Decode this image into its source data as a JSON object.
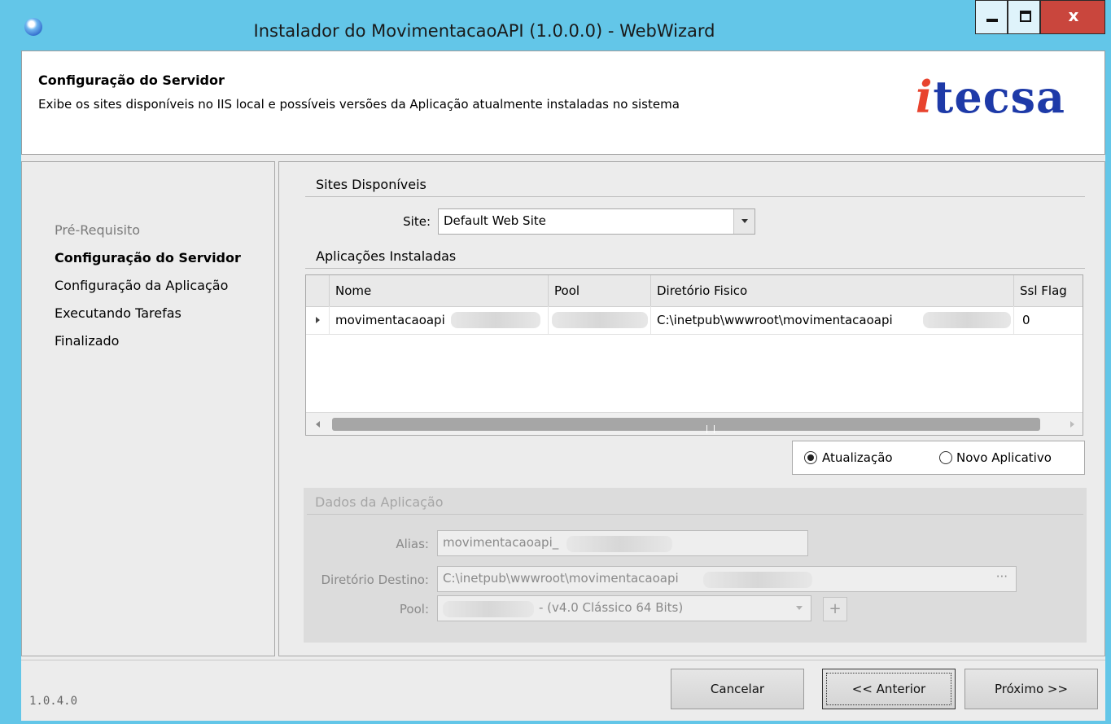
{
  "window": {
    "title": "Instalador do MovimentacaoAPI (1.0.0.0) - WebWizard",
    "close_label": "x"
  },
  "header": {
    "title": "Configuração do Servidor",
    "subtitle": "Exibe os sites disponíveis no IIS local e possíveis versões da Aplicação atualmente instaladas no sistema",
    "logo_i": "i",
    "logo_rest": "tecsa"
  },
  "steps": [
    "Pré-Requisito",
    "Configuração do Servidor",
    "Configuração da Aplicação",
    "Executando Tarefas",
    "Finalizado"
  ],
  "sites": {
    "group_title": "Sites Disponíveis",
    "site_label": "Site:",
    "site_value": "Default Web Site"
  },
  "apps": {
    "group_title": "Aplicações Instaladas",
    "columns": [
      "Nome",
      "Pool",
      "Diretório Fisico",
      "Ssl Flag"
    ],
    "rows": [
      {
        "nome": "movimentacaoapi",
        "pool": "",
        "diretorio": "C:\\inetpub\\wwwroot\\movimentacaoapi",
        "ssl": "0"
      }
    ]
  },
  "mode": {
    "update_label": "Atualização",
    "new_label": "Novo Aplicativo",
    "selected": "update"
  },
  "dados": {
    "group_title": "Dados da Aplicação",
    "alias_label": "Alias:",
    "alias_value": "movimentacaoapi_",
    "dir_label": "Diretório Destino:",
    "dir_value": "C:\\inetpub\\wwwroot\\movimentacaoapi",
    "dir_browse": "···",
    "pool_label": "Pool:",
    "pool_value": "- (v4.0 Clássico 64 Bits)",
    "add_label": "+"
  },
  "footer": {
    "version": "1.0.4.0",
    "cancel": "Cancelar",
    "back": "<< Anterior",
    "next": "Próximo >>"
  }
}
